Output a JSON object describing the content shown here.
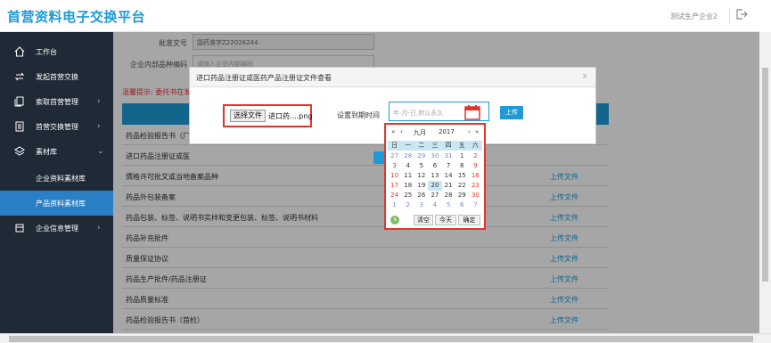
{
  "header": {
    "title": "首营资料电子交换平台",
    "company": "测试生产企业2",
    "logout_icon": "logout-icon"
  },
  "sidebar": {
    "items": [
      {
        "label": "工作台",
        "icon": "home-icon"
      },
      {
        "label": "发起首营交换",
        "icon": "exchange-icon"
      },
      {
        "label": "索取首营管理",
        "icon": "request-icon",
        "arrow": "›"
      },
      {
        "label": "首营交换管理",
        "icon": "doc-icon",
        "arrow": "›"
      },
      {
        "label": "素材库",
        "icon": "layers-icon",
        "arrow": "⌄"
      },
      {
        "label": "企业资料素材库"
      },
      {
        "label": "产品资料素材库"
      },
      {
        "label": "企业信息管理",
        "icon": "building-icon",
        "arrow": "›"
      }
    ]
  },
  "form": {
    "approval_label": "批准文号",
    "approval_value": "国药准字Z22026244",
    "internal_label": "企业内部品种编码",
    "internal_placeholder": "请输入企业内部编码"
  },
  "hint": "温馨提示: 委托书在发",
  "table": {
    "rows": [
      {
        "name": "药品检验报告书（厂",
        "action": ""
      },
      {
        "name": "进口药品注册证或医",
        "action": ""
      },
      {
        "name": "價格许可批文或当地备案品种",
        "action": "上传文件"
      },
      {
        "name": "药品外包装备案",
        "action": "上传文件"
      },
      {
        "name": "药品包装、标签、说明书实样和变更包装、标签、说明书材料",
        "action": "上传文件"
      },
      {
        "name": "药品补充批件",
        "action": "上传文件"
      },
      {
        "name": "质量保证协议",
        "action": "上传文件"
      },
      {
        "name": "药品生产批件/药品注册证",
        "action": "上传文件"
      },
      {
        "name": "药品质量标准",
        "action": "上传文件"
      },
      {
        "name": "药品检验报告书（首检）",
        "action": "上传文件"
      }
    ]
  },
  "modal": {
    "title": "进口药品注册证或医药产品注册证文件查看",
    "close": "x",
    "choose_file": "选择文件",
    "file_name": "进口药....png",
    "date_label": "设置到期时间",
    "date_placeholder": "年-月-日,默认永久",
    "upload": "上传"
  },
  "calendar": {
    "prev_year": "«",
    "prev_month": "‹",
    "month": "九月",
    "year": "2017",
    "next_month": "›",
    "next_year": "»",
    "weekdays": [
      "日",
      "一",
      "二",
      "三",
      "四",
      "五",
      "六"
    ],
    "weeks": [
      [
        "27",
        "28",
        "29",
        "30",
        "31",
        "1",
        "2"
      ],
      [
        "3",
        "4",
        "5",
        "6",
        "7",
        "8",
        "9"
      ],
      [
        "10",
        "11",
        "12",
        "13",
        "14",
        "15",
        "16"
      ],
      [
        "17",
        "18",
        "19",
        "20",
        "21",
        "22",
        "23"
      ],
      [
        "24",
        "25",
        "26",
        "27",
        "28",
        "29",
        "30"
      ],
      [
        "1",
        "2",
        "3",
        "4",
        "5",
        "6",
        "7"
      ]
    ],
    "clear": "清空",
    "today": "今天",
    "ok": "确定"
  }
}
